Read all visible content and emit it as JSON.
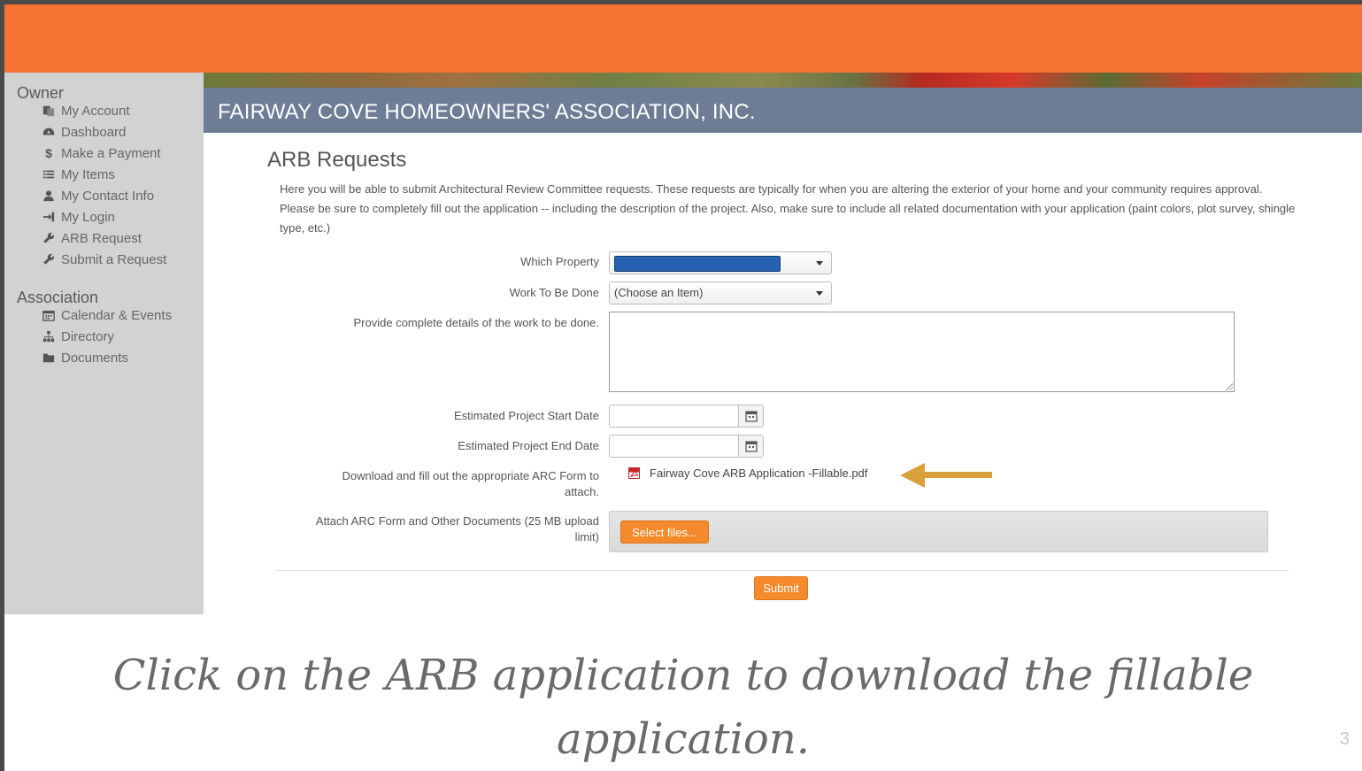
{
  "sidebar": {
    "owner_heading": "Owner",
    "owner_items": [
      {
        "label": "My Account",
        "icon": "account-icon"
      },
      {
        "label": "Dashboard",
        "icon": "dashboard-icon"
      },
      {
        "label": "Make a Payment",
        "icon": "dollar-icon"
      },
      {
        "label": "My Items",
        "icon": "list-icon"
      },
      {
        "label": "My Contact Info",
        "icon": "user-icon"
      },
      {
        "label": "My Login",
        "icon": "login-icon"
      },
      {
        "label": "ARB Request",
        "icon": "wrench-icon"
      },
      {
        "label": "Submit a Request",
        "icon": "wrench-icon"
      }
    ],
    "association_heading": "Association",
    "association_items": [
      {
        "label": "Calendar & Events",
        "icon": "calendar-icon"
      },
      {
        "label": "Directory",
        "icon": "sitemap-icon"
      },
      {
        "label": "Documents",
        "icon": "folder-icon"
      }
    ]
  },
  "header": {
    "title": "FAIRWAY COVE HOMEOWNERS' ASSOCIATION, INC."
  },
  "main": {
    "title": "ARB Requests",
    "intro": "Here you will be able to submit Architectural Review Committee requests. These requests are typically for when you are altering the exterior of your home and your community requires approval. Please be sure to completely fill out the application -- including the description of the project. Also, make sure to include all related documentation with your application (paint colors, plot survey, shingle type, etc.)",
    "form": {
      "property_label": "Which Property",
      "property_value": "",
      "work_label": "Work To Be Done",
      "work_value": "(Choose an Item)",
      "details_label": "Provide complete details of the work to be done.",
      "details_value": "",
      "start_label": "Estimated Project Start Date",
      "start_value": "",
      "end_label": "Estimated Project End Date",
      "end_value": "",
      "download_label": "Download and fill out the appropriate ARC Form to attach.",
      "download_file": "Fairway Cove ARB Application -Fillable.pdf",
      "attach_label": "Attach ARC Form and Other Documents (25 MB upload limit)",
      "select_files_label": "Select files...",
      "submit_label": "Submit"
    }
  },
  "caption": {
    "line1": "Click on the ARB application to download the fillable",
    "line2": "application."
  },
  "slide_number": "3",
  "colors": {
    "top_bar": "#f57232",
    "banner": "#6d7d96",
    "sidebar": "#d2d2d2",
    "button": "#f58a2c",
    "arrow": "#d9a13a"
  }
}
